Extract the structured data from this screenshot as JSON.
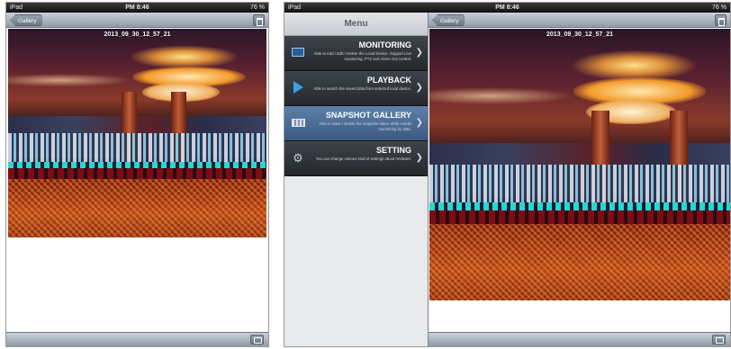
{
  "status_bar": {
    "carrier": "iPad",
    "time": "PM 8:46",
    "battery": "76 %"
  },
  "left_screen": {
    "nav": {
      "back_label": "Gallery",
      "delete_icon": "trash-icon"
    },
    "photo": {
      "timestamp": "2013_09_30_12_57_21"
    },
    "toolbar": {
      "snapshot_icon": "camera-icon"
    }
  },
  "right_screen": {
    "nav": {
      "back_label": "Gallery",
      "delete_icon": "trash-icon"
    },
    "photo": {
      "timestamp": "2013_09_30_12_57_21"
    },
    "toolbar": {
      "snapshot_icon": "camera-icon"
    },
    "menu": {
      "title": "Menu",
      "items": [
        {
          "title": "MONITORING",
          "description": "Able to Add / Edit / Delete the Local Device. Support Live monitoring, PTZ and Alarm Out control.",
          "icon": "monitor-icon",
          "selected": false
        },
        {
          "title": "PLAYBACK",
          "description": "Able to search the saved data from selected local device.",
          "icon": "play-icon",
          "selected": false
        },
        {
          "title": "SNAPSHOT GALLERY",
          "description": "Able to Save / Delete the snapshot taken while mobile monitoring by date.",
          "icon": "film-icon",
          "selected": true
        },
        {
          "title": "SETTING",
          "description": "You can change various kind of settings about mViewer.",
          "icon": "gear-icon",
          "selected": false
        }
      ]
    }
  }
}
